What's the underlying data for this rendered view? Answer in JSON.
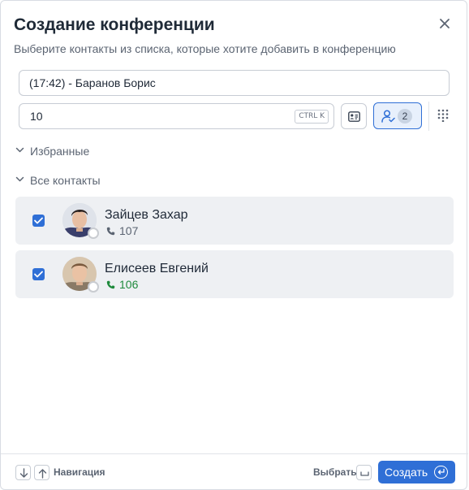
{
  "dialog": {
    "title": "Создание конференции",
    "subtitle": "Выберите контакты из списка, которые хотите добавить в конференцию"
  },
  "conference_name": {
    "value": "(17:42) - Баранов Борис"
  },
  "search": {
    "value": "10",
    "shortcut": "CTRL K"
  },
  "toolbar": {
    "selected_count": "2"
  },
  "sections": {
    "favorites_label": "Избранные",
    "all_contacts_label": "Все контакты"
  },
  "contacts": [
    {
      "name": "Зайцев Захар",
      "phone": "107",
      "checked": true,
      "phone_color": "#5b6472",
      "status": "offline"
    },
    {
      "name": "Елисеев Евгений",
      "phone": "106",
      "checked": true,
      "phone_color": "#1e8a3c",
      "status": "offline"
    }
  ],
  "footer": {
    "navigation_label": "Навигация",
    "select_label": "Выбрать",
    "create_label": "Создать"
  },
  "colors": {
    "accent": "#2f6fd6",
    "row_background": "#eef0f3",
    "available_phone": "#1e8a3c"
  }
}
